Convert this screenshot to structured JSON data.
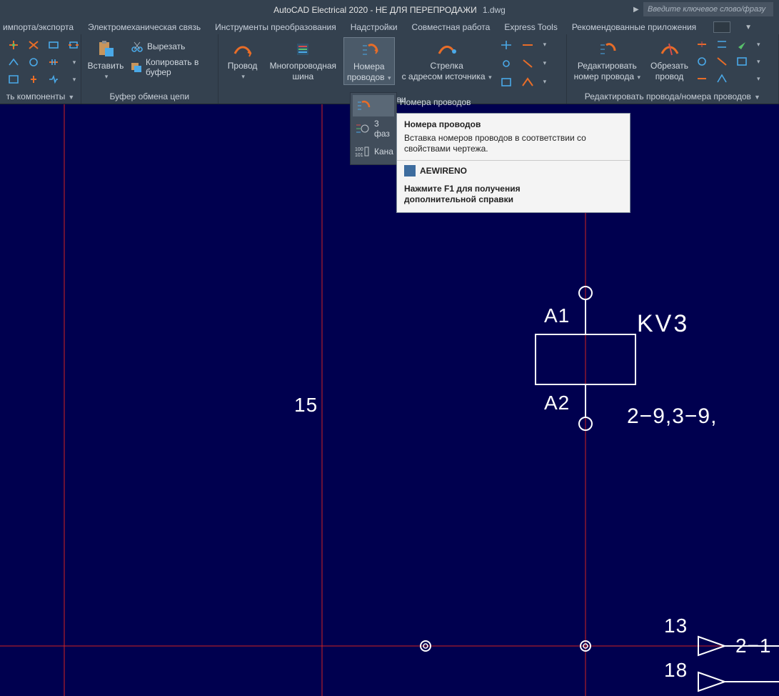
{
  "title_app": "AutoCAD Electrical 2020 - НЕ ДЛЯ ПЕРЕПРОДАЖИ",
  "title_doc": "1.dwg",
  "search_placeholder": "Введите ключевое слово/фразу",
  "tabs": {
    "t0": "импорта/экспорта",
    "t1": "Электромеханическая связь",
    "t2": "Инструменты преобразования",
    "t3": "Надстройки",
    "t4": "Совместная работа",
    "t5": "Express Tools",
    "t6": "Рекомендованные приложения"
  },
  "panels": {
    "components": "ть компоненты",
    "clipboard_title": "Буфер обмена цепи",
    "insert_title": "Встави",
    "edit_title": "Редактировать провода/номера проводов"
  },
  "clipboard": {
    "paste": "Вставить",
    "cut": "Вырезать",
    "copy": "Копировать в буфер"
  },
  "insert": {
    "wire": "Провод",
    "multiwire_l1": "Многопроводная",
    "multiwire_l2": "шина",
    "numbers_l1": "Номера",
    "numbers_l2": "проводов",
    "arrow_l1": "Стрелка",
    "arrow_l2": "с адресом источника"
  },
  "edit": {
    "editnum_l1": "Редактировать",
    "editnum_l2": "номер провода",
    "trim_l1": "Обрезать",
    "trim_l2": "провод"
  },
  "dropdown": {
    "item1": "Номера  проводов",
    "item2": "3 фаз",
    "item3": "Кана"
  },
  "tooltip": {
    "title": "Номера проводов",
    "body": "Вставка номеров проводов в соответствии со свойствами чертежа.",
    "cmd": "AEWIRENO",
    "help_l1": "Нажмите F1 для получения",
    "help_l2": "дополнительной справки"
  },
  "canvas": {
    "n15": "15",
    "a1": "A1",
    "a2": "A2",
    "kv3": "KV3",
    "eq": "2−9,3−9,",
    "n13": "13",
    "n18": "18",
    "n2_1": "2−1"
  }
}
